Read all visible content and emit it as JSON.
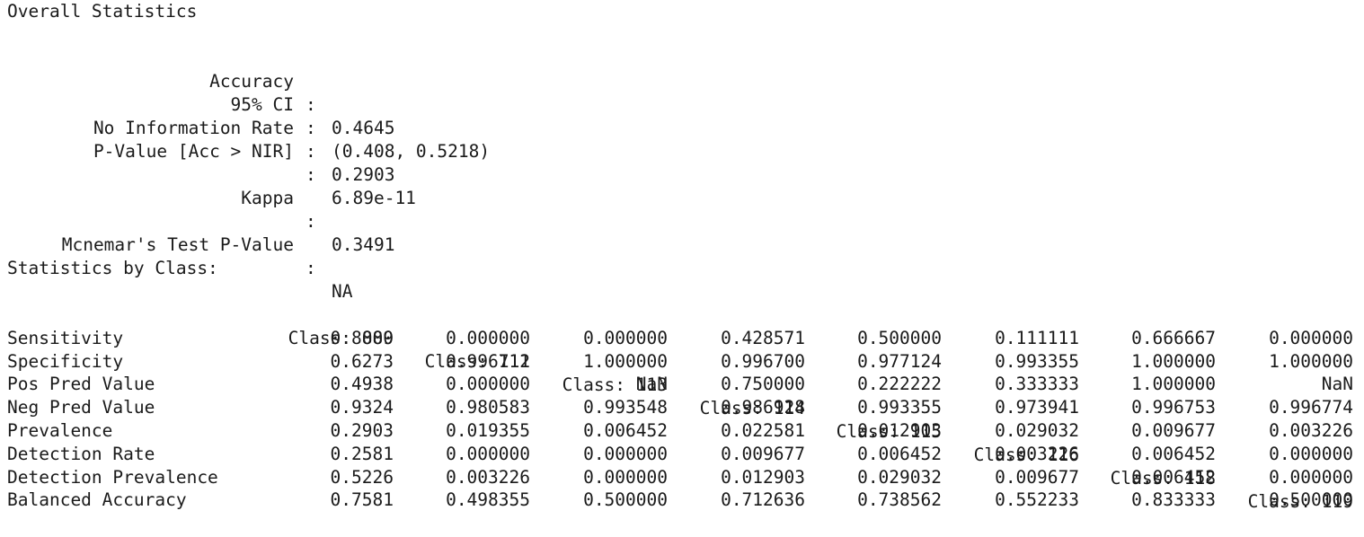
{
  "overall": {
    "heading": "Overall Statistics",
    "stats": [
      {
        "label": "Accuracy",
        "value": "0.4645"
      },
      {
        "label": "95% CI",
        "value": "(0.408, 0.5218)"
      },
      {
        "label": "No Information Rate",
        "value": "0.2903"
      },
      {
        "label": "P-Value [Acc > NIR]",
        "value": "6.89e-11"
      },
      {
        "label": "Kappa",
        "value": "0.3491"
      },
      {
        "label": "Mcnemar's Test P-Value",
        "value": "NA"
      }
    ],
    "separator": ":"
  },
  "by_class": {
    "heading": "Statistics by Class:",
    "columns": [
      "Class: 000",
      "Class: 112",
      "Class: 113",
      "Class: 114",
      "Class: 115",
      "Class: 116",
      "Class: 118",
      "Class: 119"
    ],
    "rows": [
      {
        "label": "Sensitivity",
        "cells": [
          "0.8889",
          "0.000000",
          "0.000000",
          "0.428571",
          "0.500000",
          "0.111111",
          "0.666667",
          "0.000000"
        ]
      },
      {
        "label": "Specificity",
        "cells": [
          "0.6273",
          "0.996711",
          "1.000000",
          "0.996700",
          "0.977124",
          "0.993355",
          "1.000000",
          "1.000000"
        ]
      },
      {
        "label": "Pos Pred Value",
        "cells": [
          "0.4938",
          "0.000000",
          "NaN",
          "0.750000",
          "0.222222",
          "0.333333",
          "1.000000",
          "NaN"
        ]
      },
      {
        "label": "Neg Pred Value",
        "cells": [
          "0.9324",
          "0.980583",
          "0.993548",
          "0.986928",
          "0.993355",
          "0.973941",
          "0.996753",
          "0.996774"
        ]
      },
      {
        "label": "Prevalence",
        "cells": [
          "0.2903",
          "0.019355",
          "0.006452",
          "0.022581",
          "0.012903",
          "0.029032",
          "0.009677",
          "0.003226"
        ]
      },
      {
        "label": "Detection Rate",
        "cells": [
          "0.2581",
          "0.000000",
          "0.000000",
          "0.009677",
          "0.006452",
          "0.003226",
          "0.006452",
          "0.000000"
        ]
      },
      {
        "label": "Detection Prevalence",
        "cells": [
          "0.5226",
          "0.003226",
          "0.000000",
          "0.012903",
          "0.029032",
          "0.009677",
          "0.006452",
          "0.000000"
        ]
      },
      {
        "label": "Balanced Accuracy",
        "cells": [
          "0.7581",
          "0.498355",
          "0.500000",
          "0.712636",
          "0.738562",
          "0.552233",
          "0.833333",
          "0.500000"
        ]
      }
    ]
  }
}
